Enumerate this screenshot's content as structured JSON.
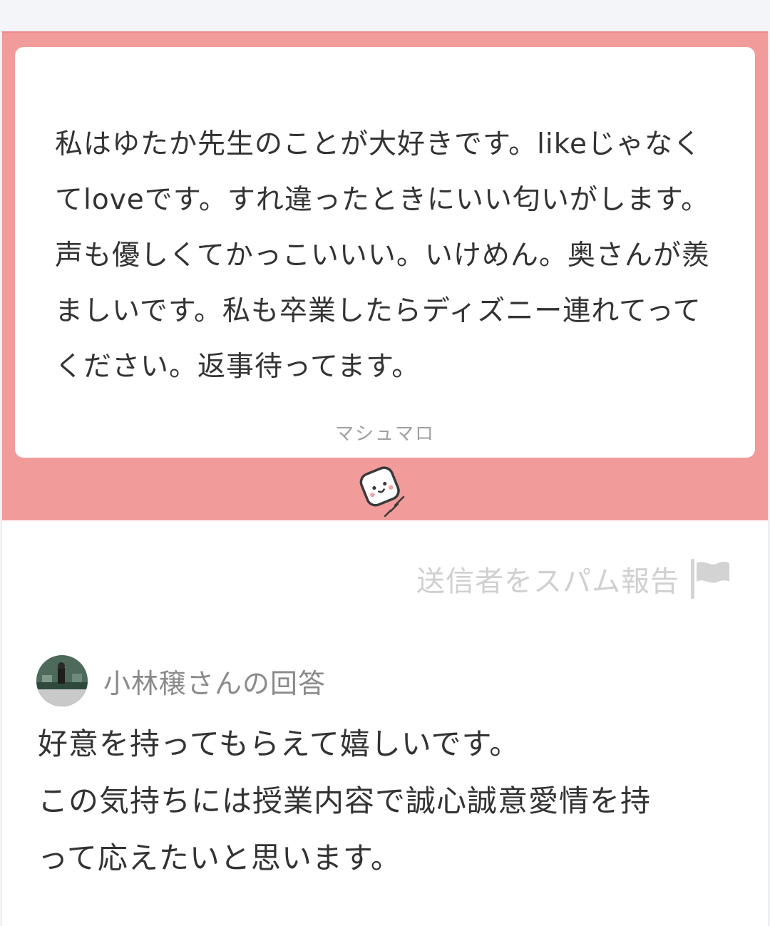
{
  "question": {
    "text": "私はゆたか先生のことが大好きです。likeじゃなくてloveです。すれ違ったときにいい匂いがします。声も優しくてかっこいいい。いけめん。奥さんが羨ましいです。私も卒業したらディズニー連れてってください。返事待ってます。",
    "brand_label": "マシュマロ"
  },
  "report": {
    "label": "送信者をスパム報告",
    "icon": "flag-icon"
  },
  "answer": {
    "author_label": "小林穣さんの回答",
    "lines": [
      "好意を持ってもらえて嬉しいです。",
      "この気持ちには授業内容で誠心誠意愛情を持",
      "って応えたいと思います。"
    ]
  },
  "colors": {
    "band": "#f19b9b",
    "text": "#333333",
    "muted": "#8a8a8a",
    "report": "#d0d0d0"
  }
}
